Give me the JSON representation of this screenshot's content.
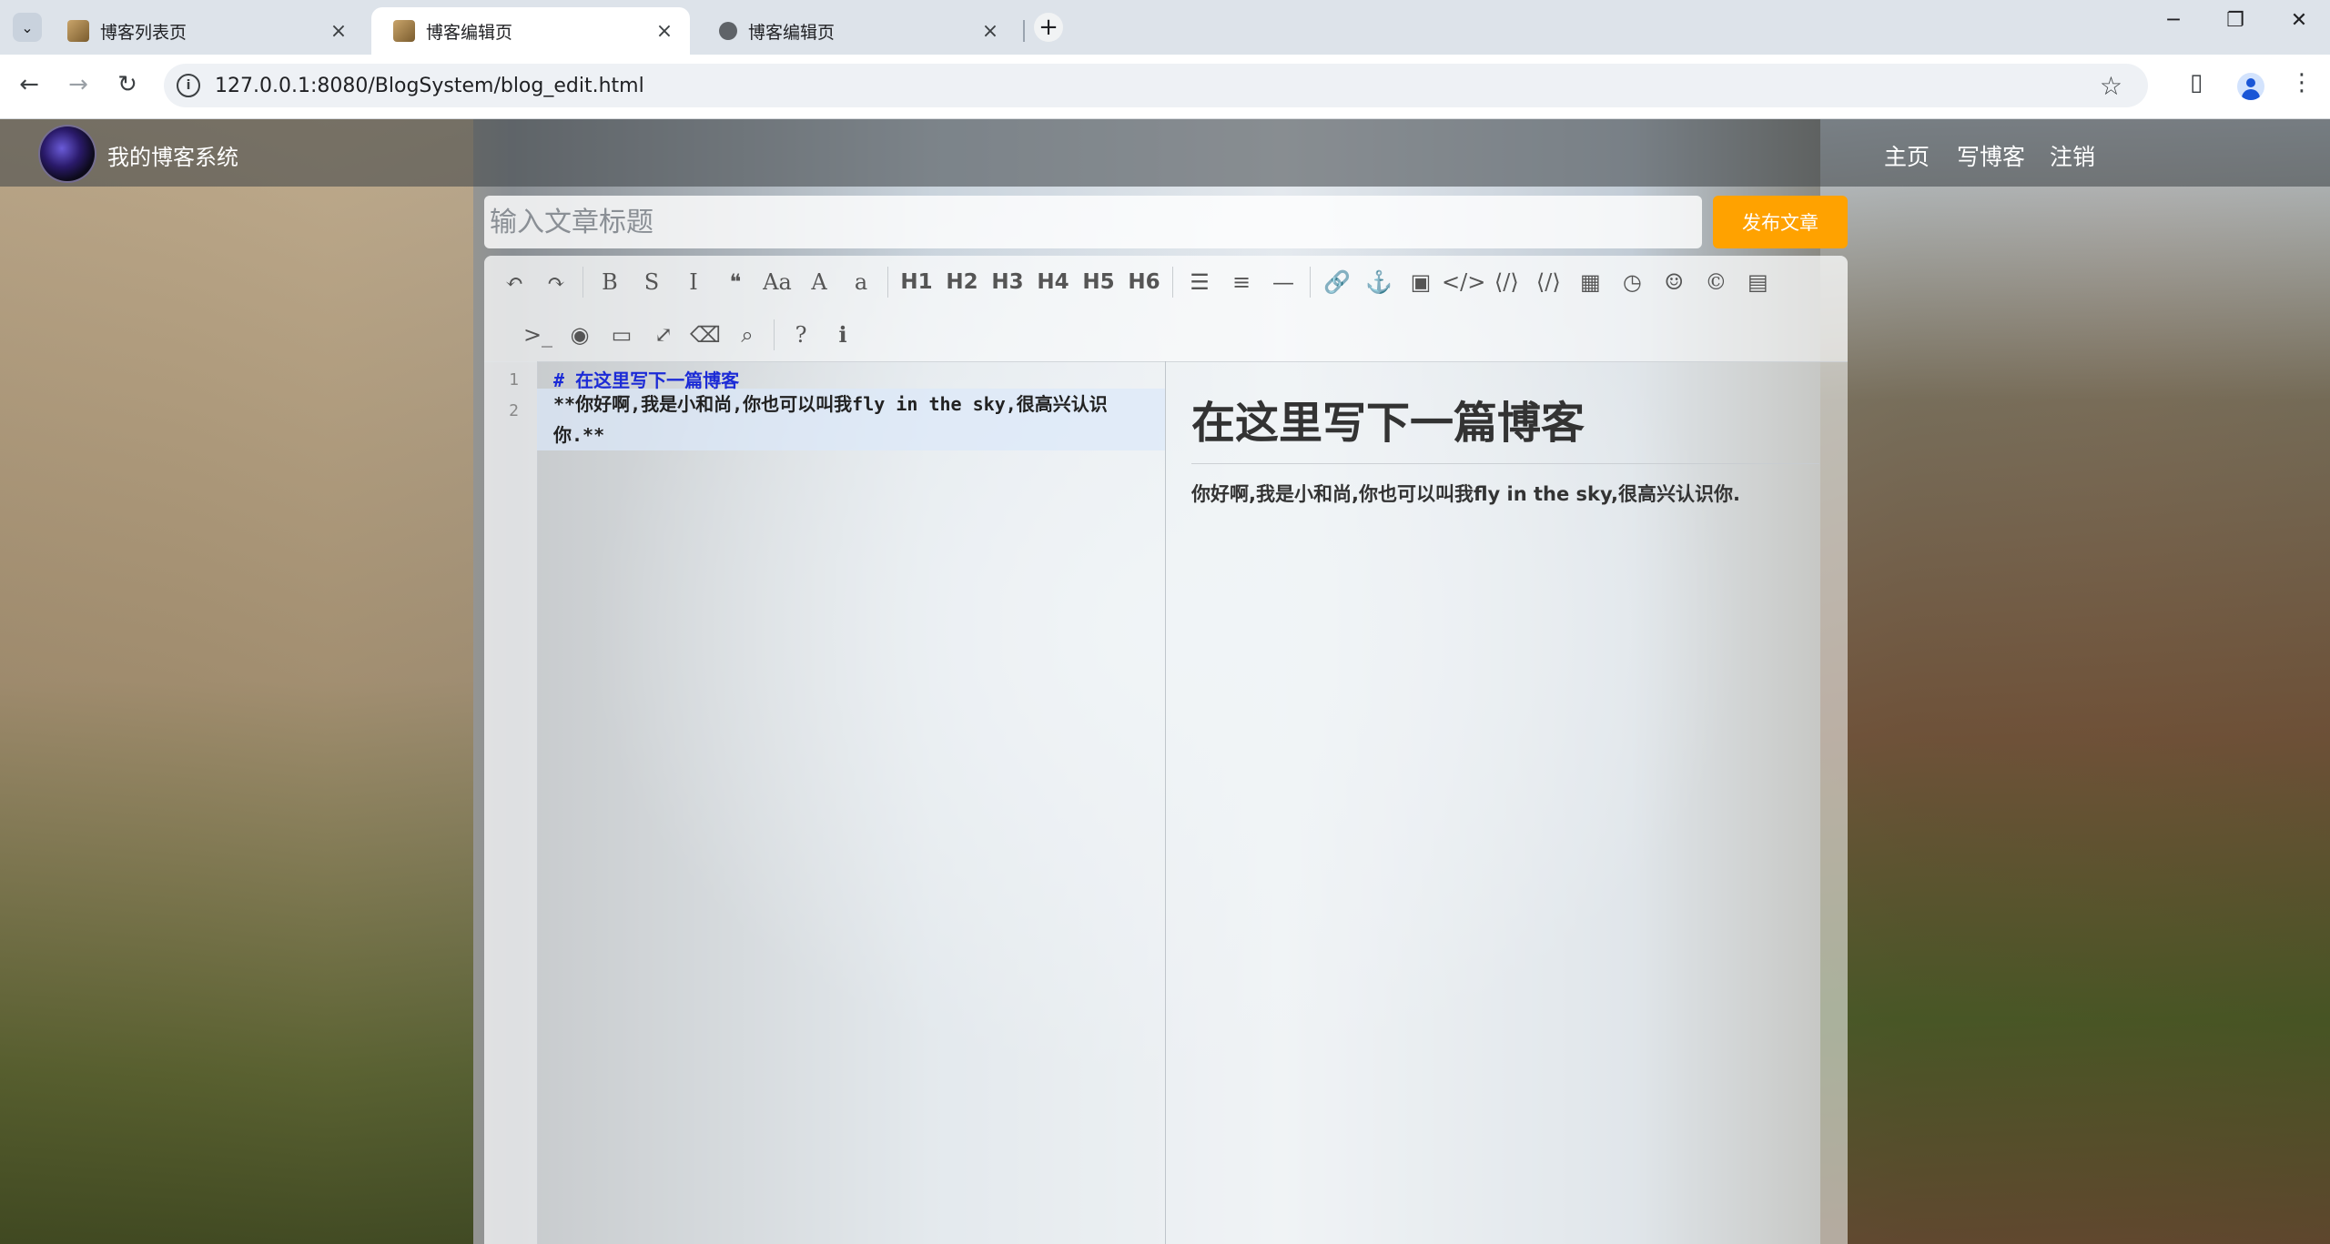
{
  "browser": {
    "tabs": [
      {
        "title": "博客列表页",
        "active": false
      },
      {
        "title": "博客编辑页",
        "active": true
      },
      {
        "title": "博客编辑页",
        "active": false
      }
    ],
    "url": "127.0.0.1:8080/BlogSystem/blog_edit.html",
    "icons": {
      "back": "←",
      "forward": "→",
      "reload": "↻",
      "info": "i",
      "star": "☆",
      "close": "×",
      "new_tab": "+",
      "minimize": "─",
      "restore": "❐",
      "window_close": "✕",
      "menu": "⋮",
      "tab_search": "⌄",
      "side_panel": "▯"
    }
  },
  "navbar": {
    "site_title": "我的博客系统",
    "links": [
      "主页",
      "写博客",
      "注销"
    ]
  },
  "editor": {
    "title_placeholder": "输入文章标题",
    "publish_label": "发布文章",
    "toolbar_row1": [
      "↶",
      "↷",
      "|",
      "B",
      "S",
      "I",
      "❝",
      "Aa",
      "A",
      "a",
      "|",
      "H1",
      "H2",
      "H3",
      "H4",
      "H5",
      "H6",
      "|",
      "☰",
      "≡",
      "—",
      "|",
      "🔗",
      "⚓",
      "▣",
      "</>",
      "⟨/⟩",
      "⟨/⟩",
      "▦",
      "◷",
      "☺",
      "©",
      "▤"
    ],
    "toolbar_row2": [
      ">_",
      "◉",
      "▭",
      "⤢",
      "⌫",
      "⌕",
      "|",
      "?",
      "ℹ"
    ],
    "code_lines": [
      {
        "no": "1",
        "text": "# 在这里写下一篇博客"
      },
      {
        "no": "2",
        "text": "**你好啊,我是小和尚,你也可以叫我fly in the sky,很高兴认识你.**"
      }
    ],
    "preview": {
      "heading": "在这里写下一篇博客",
      "paragraph": "你好啊,我是小和尚,你也可以叫我fly in the sky,很高兴认识你."
    }
  },
  "colors": {
    "publish_button": "#ffa200",
    "markdown_heading": "#1c2bd6",
    "navbar_bg": "rgba(60,65,70,0.55)"
  }
}
